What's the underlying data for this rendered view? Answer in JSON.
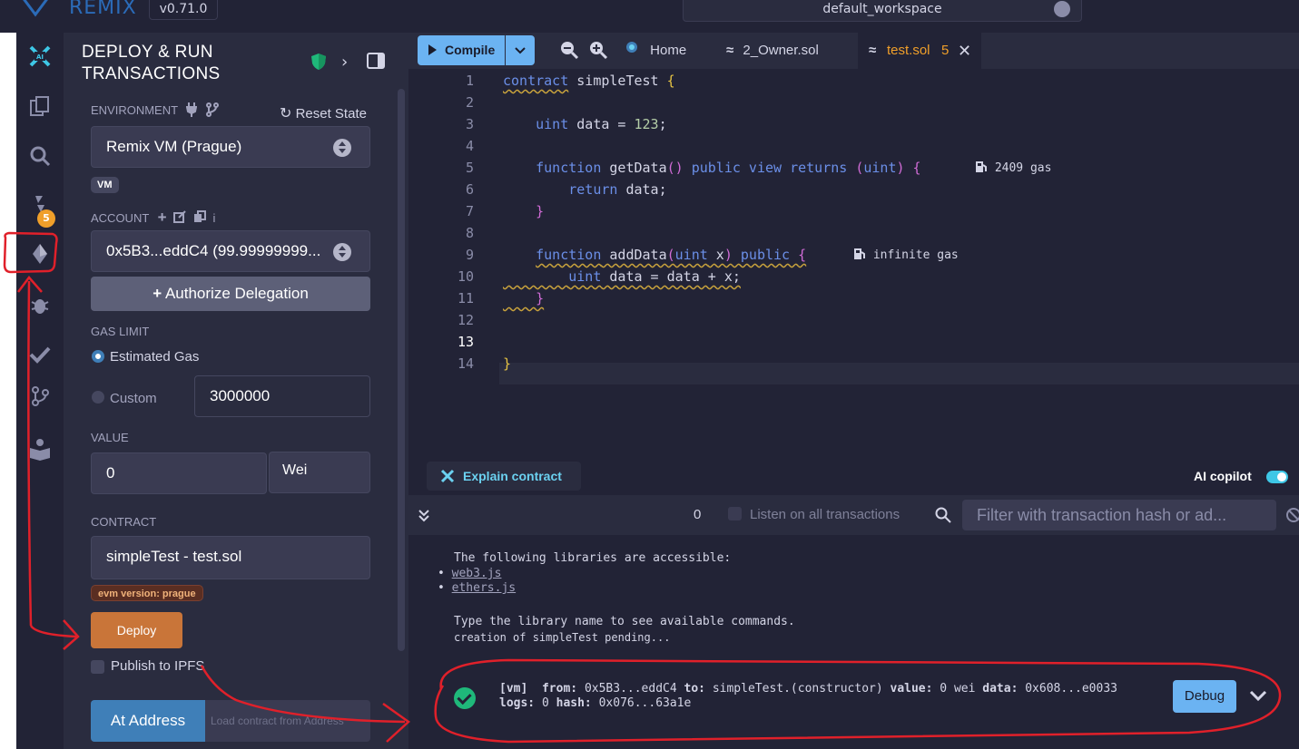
{
  "app": {
    "name": "REMIX",
    "version": "v0.71.0",
    "workspace": "default_workspace"
  },
  "sidebar": {
    "icons": [
      "ai-icon",
      "file-explorer-icon",
      "search-icon",
      "solidity-compiler-icon",
      "deploy-run-icon",
      "debugger-icon",
      "test-icon",
      "git-icon",
      "learn-icon"
    ],
    "compiler_badge": "5"
  },
  "panel": {
    "title_line1": "DEPLOY & RUN",
    "title_line2": "TRANSACTIONS",
    "environment": {
      "label": "ENVIRONMENT",
      "reset_label": "Reset State",
      "value": "Remix VM (Prague)",
      "badge": "VM"
    },
    "account": {
      "label": "ACCOUNT",
      "info": "i",
      "value": "0x5B3...eddC4 (99.99999999..."
    },
    "authorize_label": "Authorize Delegation",
    "gas_limit": {
      "label": "GAS LIMIT",
      "estimated_label": "Estimated Gas",
      "custom_label": "Custom",
      "custom_value": "3000000"
    },
    "value": {
      "label": "VALUE",
      "amount": "0",
      "unit": "Wei"
    },
    "contract": {
      "label": "CONTRACT",
      "value": "simpleTest - test.sol",
      "evm_badge": "evm version: prague"
    },
    "deploy_label": "Deploy",
    "publish_label": "Publish to IPFS",
    "at_address_label": "At Address",
    "at_address_placeholder": "Load contract from Address"
  },
  "editor": {
    "compile_label": "Compile",
    "tabs": [
      {
        "label": "Home"
      },
      {
        "label": "2_Owner.sol"
      },
      {
        "label": "test.sol",
        "count": "5",
        "active": true
      }
    ],
    "line_numbers": [
      "1",
      "2",
      "3",
      "4",
      "5",
      "6",
      "7",
      "8",
      "9",
      "10",
      "11",
      "12",
      "13",
      "14"
    ],
    "code": {
      "l1_kw": "contract",
      "l1_name": " simpleTest ",
      "l1_brace": "{",
      "l3_type": "uint",
      "l3_rest": " data = ",
      "l3_num": "123",
      "l3_end": ";",
      "l5_kw": "function",
      "l5_name": " getData",
      "l5_paren": "()",
      "l5_mods": " public view returns ",
      "l5_ret_open": "(",
      "l5_ret": "uint",
      "l5_ret_close": ")",
      "l5_brace": " {",
      "l6_kw": "return",
      "l6_rest": " data;",
      "l7_brace": "}",
      "l9_kw": "function",
      "l9_name": " addData",
      "l9_open": "(",
      "l9_type": "uint",
      "l9_arg": " x",
      "l9_close": ")",
      "l9_mods": " public ",
      "l9_brace": "{",
      "l10_type": "uint",
      "l10_rest": " data = data + x;",
      "l11_brace": "}",
      "l14_brace": "}"
    },
    "gas_getdata": "2409 gas",
    "gas_adddata": "infinite gas"
  },
  "copilot": {
    "explain_label": "Explain contract",
    "ai_label": "AI copilot",
    "enabled": true
  },
  "terminal": {
    "tx_count": "0",
    "listen_label": "Listen on all transactions",
    "filter_placeholder": "Filter with transaction hash or ad...",
    "lines": {
      "libs": "The following libraries are accessible:",
      "web3": "web3.js",
      "ethers": "ethers.js",
      "type_hint": "Type the library name to see available commands.",
      "pending": "creation of simpleTest pending..."
    },
    "tx": {
      "vm": "[vm]",
      "from_label": "from:",
      "from": "0x5B3...eddC4",
      "to_label": "to:",
      "to": "simpleTest.(constructor)",
      "value_label": "value:",
      "value": "0 wei",
      "data_label": "data:",
      "data": "0x608...e0033",
      "logs_label": "logs:",
      "logs": "0",
      "hash_label": "hash:",
      "hash": "0x076...63a1e"
    },
    "debug_label": "Debug"
  },
  "colors": {
    "accent": "#6bb3f2",
    "deploy": "#c97539",
    "annotation": "#e0202a",
    "warning": "#f09f2a"
  }
}
